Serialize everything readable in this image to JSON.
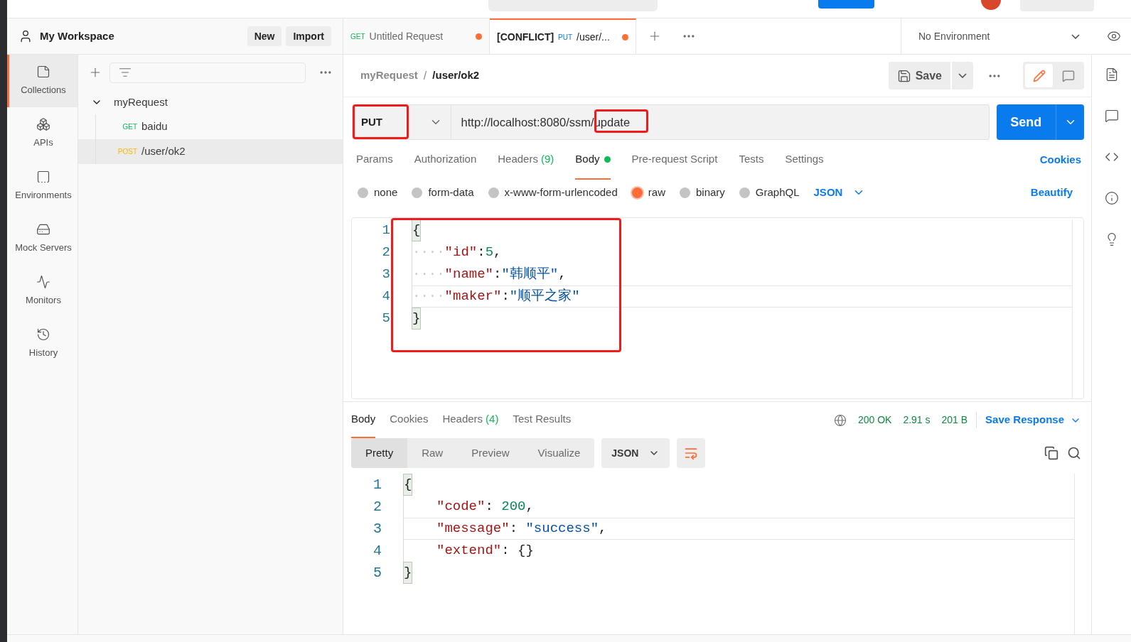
{
  "workspace": {
    "name": "My Workspace",
    "buttons": [
      "New",
      "Import"
    ]
  },
  "nav": [
    {
      "label": "Collections",
      "selected": true
    },
    {
      "label": "APIs",
      "selected": false
    },
    {
      "label": "Environments",
      "selected": false
    },
    {
      "label": "Mock Servers",
      "selected": false
    },
    {
      "label": "Monitors",
      "selected": false
    },
    {
      "label": "History",
      "selected": false
    }
  ],
  "tree": {
    "name": "myRequest",
    "expanded": true,
    "children": [
      {
        "method": "GET",
        "name": "baidu",
        "selected": false
      },
      {
        "method": "POST",
        "name": "/user/ok2",
        "selected": true
      }
    ]
  },
  "tabs": [
    {
      "method": "GET",
      "title": "Untitled Request",
      "unsaved": true,
      "selected": false
    },
    {
      "prefix": "[CONFLICT]",
      "method": "PUT",
      "title": "/user/...",
      "unsaved": true,
      "selected": true
    }
  ],
  "environment": "No Environment",
  "breadcrumb": [
    "myRequest",
    "/",
    "/user/ok2"
  ],
  "modes": [
    {
      "kind": "edit",
      "selected": true
    },
    {
      "kind": "comment",
      "selected": false
    }
  ],
  "save": "Save",
  "request": {
    "method": "PUT",
    "url": "http://localhost:8080/ssm/update",
    "send": "Send"
  },
  "param_tabs": [
    {
      "label": "Params",
      "dot": false,
      "selected": false
    },
    {
      "label": "Authorization",
      "dot": false,
      "selected": false
    },
    {
      "label": "Headers",
      "count": "(9)",
      "dot": false,
      "selected": false
    },
    {
      "label": "Body",
      "dot": true,
      "selected": true
    },
    {
      "label": "Pre-request Script",
      "dot": false,
      "selected": false
    },
    {
      "label": "Tests",
      "dot": false,
      "selected": false
    },
    {
      "label": "Settings",
      "dot": false,
      "selected": false
    }
  ],
  "cookies": "Cookies",
  "body_types": [
    {
      "label": "none",
      "selected": false
    },
    {
      "label": "form-data",
      "selected": false
    },
    {
      "label": "x-www-form-urlencoded",
      "selected": false
    },
    {
      "label": "raw",
      "selected": true
    },
    {
      "label": "binary",
      "selected": false
    },
    {
      "label": "GraphQL",
      "selected": false
    }
  ],
  "body_format": "JSON",
  "beautify": "Beautify",
  "request_body": [
    {
      "number": "1",
      "active": false,
      "tokens": [
        {
          "kind": "bracket",
          "text": "{"
        }
      ]
    },
    {
      "number": "2",
      "active": false,
      "tokens": [
        {
          "kind": "indent",
          "text": "····"
        },
        {
          "kind": "key",
          "text": "\"id\""
        },
        {
          "kind": "punct",
          "text": ":"
        },
        {
          "kind": "num",
          "text": "5"
        },
        {
          "kind": "punct",
          "text": ","
        }
      ]
    },
    {
      "number": "3",
      "active": false,
      "tokens": [
        {
          "kind": "indent",
          "text": "····"
        },
        {
          "kind": "key",
          "text": "\"name\""
        },
        {
          "kind": "punct",
          "text": ":"
        },
        {
          "kind": "str",
          "text": "\"韩顺平\""
        },
        {
          "kind": "punct",
          "text": ","
        }
      ]
    },
    {
      "number": "4",
      "active": true,
      "tokens": [
        {
          "kind": "indent",
          "text": "····"
        },
        {
          "kind": "key",
          "text": "\"maker\""
        },
        {
          "kind": "punct",
          "text": ":"
        },
        {
          "kind": "str",
          "text": "\"顺平之家\""
        }
      ]
    },
    {
      "number": "5",
      "active": false,
      "tokens": [
        {
          "kind": "bracket",
          "text": "}"
        }
      ]
    }
  ],
  "response": {
    "tabs": [
      {
        "label": "Body",
        "selected": true
      },
      {
        "label": "Cookies",
        "selected": false
      },
      {
        "label": "Headers",
        "count": "(4)",
        "selected": false
      },
      {
        "label": "Test Results",
        "selected": false
      }
    ],
    "status": "200 OK",
    "time": "2.91 s",
    "size": "201 B",
    "save": "Save Response",
    "views": [
      {
        "label": "Pretty",
        "selected": true
      },
      {
        "label": "Raw",
        "selected": false
      },
      {
        "label": "Preview",
        "selected": false
      },
      {
        "label": "Visualize",
        "selected": false
      }
    ],
    "format": "JSON",
    "body": [
      {
        "number": "1",
        "active": false,
        "tokens": [
          {
            "kind": "bracket",
            "text": "{"
          }
        ]
      },
      {
        "number": "2",
        "active": false,
        "indented": true,
        "tokens": [
          {
            "kind": "key",
            "text": "\"code\""
          },
          {
            "kind": "punct",
            "text": ": "
          },
          {
            "kind": "num",
            "text": "200"
          },
          {
            "kind": "punct",
            "text": ","
          }
        ]
      },
      {
        "number": "3",
        "active": true,
        "indented": true,
        "tokens": [
          {
            "kind": "key",
            "text": "\"message\""
          },
          {
            "kind": "punct",
            "text": ": "
          },
          {
            "kind": "str",
            "text": "\"success\""
          },
          {
            "kind": "punct",
            "text": ","
          }
        ]
      },
      {
        "number": "4",
        "active": false,
        "indented": true,
        "tokens": [
          {
            "kind": "key",
            "text": "\"extend\""
          },
          {
            "kind": "punct",
            "text": ": "
          },
          {
            "kind": "punct",
            "text": "{}"
          }
        ]
      },
      {
        "number": "5",
        "active": false,
        "tokens": [
          {
            "kind": "bracket",
            "text": "}"
          }
        ]
      }
    ]
  }
}
